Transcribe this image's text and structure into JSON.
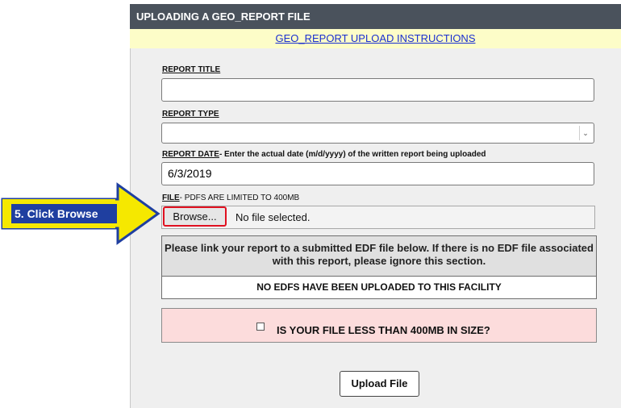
{
  "header": {
    "title": "UPLOADING A GEO_REPORT FILE"
  },
  "instructions": {
    "link_text": "GEO_REPORT UPLOAD INSTRUCTIONS"
  },
  "form": {
    "report_title": {
      "label": "REPORT TITLE",
      "value": ""
    },
    "report_type": {
      "label": "REPORT TYPE",
      "selected": ""
    },
    "report_date": {
      "label": "REPORT DATE",
      "hint": " - Enter the actual date (m/d/yyyy) of the written report being uploaded",
      "value": "6/3/2019"
    },
    "file": {
      "label": "FILE",
      "hint": " - PDFS ARE LIMITED TO 400MB",
      "browse_label": "Browse...",
      "status": "No file selected."
    },
    "edf": {
      "message": "Please link your report to a submitted EDF file below. If there is no EDF file associated with this report, please ignore this section.",
      "none_text": "NO EDFS HAVE BEEN UPLOADED TO THIS FACILITY"
    },
    "size_check": {
      "label": "IS YOUR FILE LESS THAN 400MB IN SIZE?",
      "checked": false
    },
    "upload_button": "Upload File"
  },
  "annotation": {
    "text": "5. Click Browse"
  },
  "colors": {
    "header_bg": "#4a525c",
    "instructions_bg": "#fdfdc8",
    "panel_bg": "#efefef",
    "highlight_red": "#e01020",
    "size_box_bg": "#fcdcdc",
    "callout_fill": "#f5e800",
    "callout_border": "#1f3fa0"
  }
}
